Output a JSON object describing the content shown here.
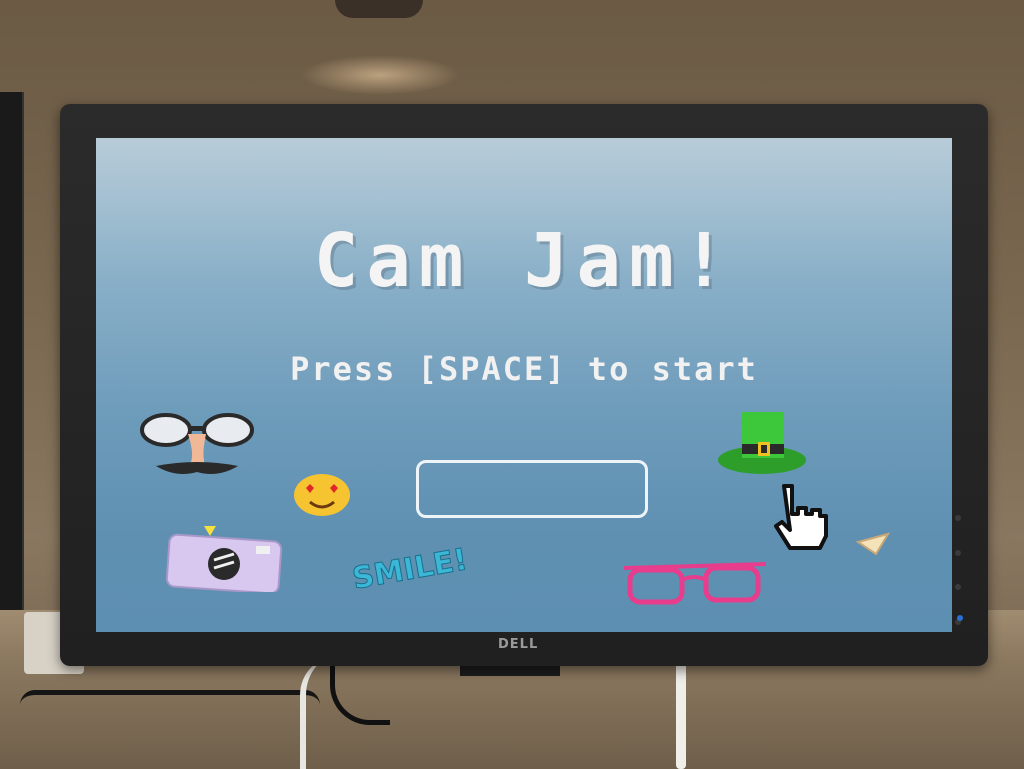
{
  "game": {
    "title": "Cam Jam!",
    "prompt": "Press [SPACE] to start",
    "name_input_value": ""
  },
  "monitor": {
    "brand": "DELL"
  },
  "stickers": {
    "smile_text": "SMILE!"
  },
  "colors": {
    "screen_top": "#b8ccd8",
    "screen_bottom": "#5d8fb2",
    "title_text": "#f4f4f4",
    "input_border": "#eef4f8",
    "smile_text": "#3bb8d8",
    "glasses_pink": "#e83c8c",
    "hat_green": "#3cc83a"
  },
  "icons": [
    "disguise-glasses-icon",
    "heart-eyes-emoji-icon",
    "camera-icon",
    "leprechaun-hat-icon",
    "pointer-hand-cursor-icon",
    "pink-glasses-icon",
    "small-triangle-icon"
  ]
}
